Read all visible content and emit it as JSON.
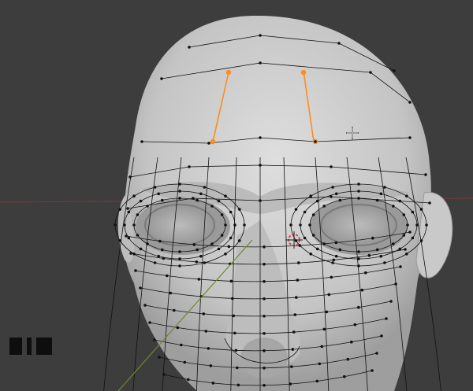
{
  "viewport": {
    "mode": "mesh-edit",
    "background_color": "#3d3d3d",
    "mesh_color": "#cfcfcf",
    "wire_color": "#111111",
    "selected_color": "#ff8c1a",
    "axis_x_color": "#7a3a3a",
    "axis_y_color": "#6b8a2a"
  },
  "overlay": {
    "stats_icon": "stats-bars-icon",
    "cursor_icon": "crosshair-cursor-icon",
    "origin_icon": "3d-cursor-icon"
  }
}
